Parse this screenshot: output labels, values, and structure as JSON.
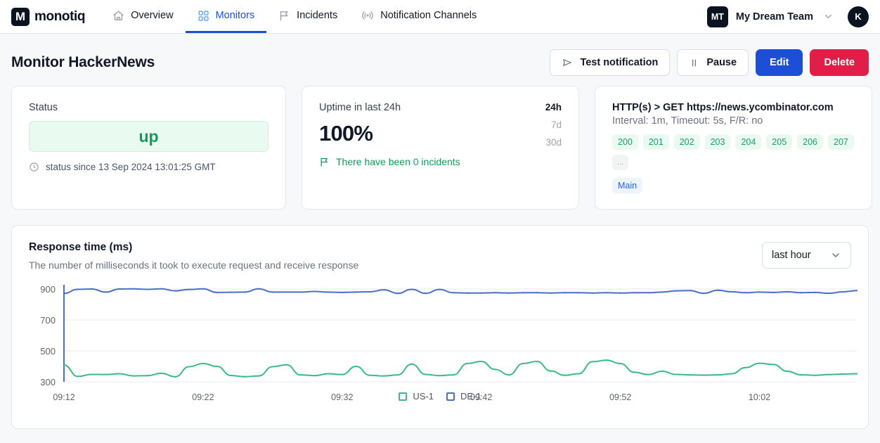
{
  "nav": {
    "brand": {
      "mark": "M",
      "word": "monotiq"
    },
    "items": [
      {
        "label": "Overview",
        "icon": "home-icon",
        "active": false
      },
      {
        "label": "Monitors",
        "icon": "grid-icon",
        "active": true
      },
      {
        "label": "Incidents",
        "icon": "flag-icon",
        "active": false
      },
      {
        "label": "Notification Channels",
        "icon": "broadcast-icon",
        "active": false
      }
    ],
    "team": {
      "badge": "MT",
      "name": "My Dream Team"
    },
    "avatar": "K"
  },
  "header": {
    "title": "Monitor HackerNews",
    "buttons": {
      "test": "Test notification",
      "pause": "Pause",
      "edit": "Edit",
      "delete": "Delete"
    }
  },
  "status_card": {
    "label": "Status",
    "value": "up",
    "since": "status since 13 Sep 2024 13:01:25 GMT"
  },
  "uptime_card": {
    "title": "Uptime in last 24h",
    "value": "100%",
    "incidents": "There have been 0 incidents",
    "ranges": [
      {
        "label": "24h",
        "active": true
      },
      {
        "label": "7d",
        "active": false
      },
      {
        "label": "30d",
        "active": false
      }
    ]
  },
  "request_card": {
    "title": "HTTP(s) > GET https://news.ycombinator.com",
    "subtitle": "Interval: 1m, Timeout: 5s, F/R: no",
    "codes": [
      "200",
      "201",
      "202",
      "203",
      "204",
      "205",
      "206",
      "207"
    ],
    "more": "...",
    "tag": "Main"
  },
  "chart_panel": {
    "title": "Response time (ms)",
    "subtitle": "The number of milliseconds it took to execute request and receive response",
    "range_selected": "last hour"
  },
  "colors": {
    "accent_blue": "#1d4ed8",
    "danger_red": "#e11d48",
    "success_green": "#0f9d58",
    "series_us1": "#3cba82",
    "series_de1": "#4a6fc4"
  },
  "chart_data": {
    "type": "line",
    "title": "Response time (ms)",
    "subtitle": "The number of milliseconds it took to execute request and receive response",
    "xlabel": "",
    "ylabel": "ms",
    "ylim": [
      300,
      900
    ],
    "yticks": [
      300,
      500,
      700,
      900
    ],
    "grid": true,
    "legend_position": "bottom",
    "x_tick_labels": [
      "09:12",
      "09:22",
      "09:32",
      "09:42",
      "09:52",
      "10:02"
    ],
    "x_tick_indices": [
      0,
      10,
      20,
      30,
      40,
      50
    ],
    "x": [
      "09:12",
      "09:13",
      "09:14",
      "09:15",
      "09:16",
      "09:17",
      "09:18",
      "09:19",
      "09:20",
      "09:21",
      "09:22",
      "09:23",
      "09:24",
      "09:25",
      "09:26",
      "09:27",
      "09:28",
      "09:29",
      "09:30",
      "09:31",
      "09:32",
      "09:33",
      "09:34",
      "09:35",
      "09:36",
      "09:37",
      "09:38",
      "09:39",
      "09:40",
      "09:41",
      "09:42",
      "09:43",
      "09:44",
      "09:45",
      "09:46",
      "09:47",
      "09:48",
      "09:49",
      "09:50",
      "09:51",
      "09:52",
      "09:53",
      "09:54",
      "09:55",
      "09:56",
      "09:57",
      "09:58",
      "09:59",
      "10:00",
      "10:01",
      "10:02",
      "10:03",
      "10:04",
      "10:05",
      "10:06",
      "10:07",
      "10:08",
      "10:09"
    ],
    "series": [
      {
        "name": "US-1",
        "color": "#3cba82",
        "values": [
          408,
          335,
          348,
          347,
          352,
          338,
          340,
          355,
          333,
          398,
          418,
          400,
          341,
          333,
          338,
          398,
          410,
          345,
          340,
          352,
          347,
          400,
          342,
          338,
          345,
          415,
          348,
          340,
          345,
          418,
          432,
          380,
          345,
          418,
          432,
          370,
          342,
          352,
          430,
          440,
          418,
          362,
          347,
          368,
          348,
          345,
          343,
          345,
          352,
          392,
          420,
          412,
          368,
          345,
          342,
          347,
          350,
          352
        ]
      },
      {
        "name": "DE-1",
        "color": "#4a6fc4",
        "values": [
          872,
          898,
          900,
          880,
          900,
          901,
          898,
          901,
          888,
          897,
          901,
          878,
          879,
          880,
          901,
          880,
          880,
          880,
          884,
          880,
          878,
          880,
          882,
          895,
          872,
          898,
          872,
          897,
          876,
          874,
          874,
          876,
          874,
          876,
          876,
          874,
          876,
          876,
          874,
          876,
          874,
          876,
          876,
          880,
          888,
          890,
          872,
          892,
          882,
          876,
          880,
          878,
          882,
          876,
          878,
          872,
          882,
          890
        ]
      }
    ],
    "legend": [
      "US-1",
      "DE-1"
    ]
  }
}
